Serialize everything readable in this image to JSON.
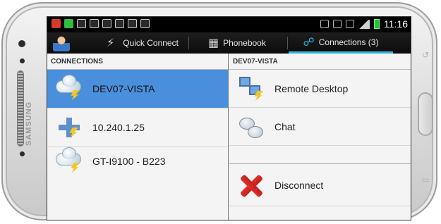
{
  "device": {
    "brand": "SAMSUNG"
  },
  "status_bar": {
    "time": "11:16"
  },
  "tabs": [
    {
      "label": "Quick Connect",
      "icon": "lightning-icon",
      "active": false
    },
    {
      "label": "Phonebook",
      "icon": "phonebook-icon",
      "active": false
    },
    {
      "label": "Connections (3)",
      "icon": "connections-icon",
      "active": true
    }
  ],
  "connections_pane": {
    "header": "CONNECTIONS",
    "items": [
      {
        "label": "DEV07-VISTA",
        "icon": "cloud-connection-icon",
        "selected": true
      },
      {
        "label": "10.240.1.25",
        "icon": "network-node-icon",
        "selected": false
      },
      {
        "label": "GT-I9100 - B223",
        "icon": "cloud-connection-icon",
        "selected": false
      }
    ]
  },
  "detail_pane": {
    "header": "DEV07-VISTA",
    "actions": [
      {
        "label": "Remote Desktop",
        "icon": "remote-desktop-icon"
      },
      {
        "label": "Chat",
        "icon": "chat-icon"
      },
      {
        "label": "Disconnect",
        "icon": "disconnect-x-icon"
      }
    ]
  },
  "colors": {
    "selection": "#4a8fdc",
    "tab_underline": "#33b5e5",
    "disconnect_red": "#d6261f"
  }
}
